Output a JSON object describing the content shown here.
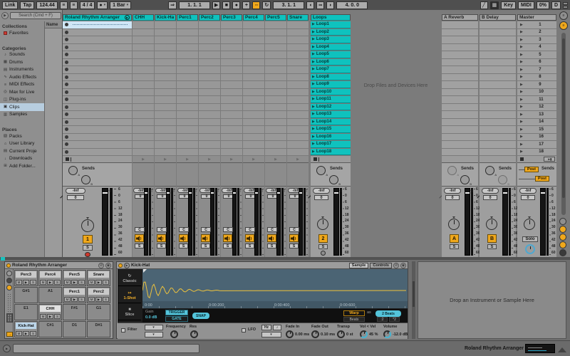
{
  "transport": {
    "link": "Link",
    "tap": "Tap",
    "tempo": "124.44",
    "time_sig": "4 / 4",
    "quantize": "1 Bar",
    "position": "1. 1. 1",
    "loop_start": "3. 1. 1",
    "loop_length": "4. 0. 0",
    "key_label": "Key",
    "midi_label": "MIDI",
    "cpu": "0%",
    "disk": "D"
  },
  "icons": {
    "dropdown": "▾",
    "nudge": "≡",
    "metronome": "●",
    "follow": "⇒",
    "play": "▶",
    "stop": "■",
    "record": "●",
    "new": "+",
    "automation_arm": "◦◦",
    "reenable_automation": "↻",
    "punch_in": "◖",
    "loop": "∞",
    "punch_out": "◗",
    "pencil": "╱",
    "keyboard": "▦",
    "browser_toggle": "▶",
    "unfold": "▶",
    "clip_play": "▶",
    "scene_play": "▶",
    "clip_stop": "■",
    "track_stop": "▶",
    "stop_all_label": "►▮",
    "hot_swap": "⊘",
    "save": "◉",
    "zero_marker": "◁",
    "overview": "≡",
    "mixer_rail": "≡",
    "arrow": "→",
    "info_play": "▶",
    "mode_classic_icon": "↻",
    "mode_oneshot_icon": "↦",
    "mode_slice_icon": "■",
    "start_flag": "▶"
  },
  "browser": {
    "search_placeholder": "Search (Cmd + F)",
    "name_header": "Name",
    "sections": [
      {
        "title": "Collections",
        "items": [
          {
            "label": "Favorites",
            "icon": "swatch"
          }
        ]
      },
      {
        "title": "Categories",
        "items": [
          {
            "label": "Sounds",
            "icon": "♪"
          },
          {
            "label": "Drums",
            "icon": "▦"
          },
          {
            "label": "Instruments",
            "icon": "▤"
          },
          {
            "label": "Audio Effects",
            "icon": "∿"
          },
          {
            "label": "MIDI Effects",
            "icon": "≡"
          },
          {
            "label": "Max for Live",
            "icon": "◎"
          },
          {
            "label": "Plug-ins",
            "icon": "◫"
          },
          {
            "label": "Clips",
            "icon": "▣",
            "selected": true
          },
          {
            "label": "Samples",
            "icon": "▥"
          }
        ]
      },
      {
        "title": "Places",
        "items": [
          {
            "label": "Packs",
            "icon": "▧"
          },
          {
            "label": "User Library",
            "icon": "⌂"
          },
          {
            "label": "Current Proje",
            "icon": "▤"
          },
          {
            "label": "Downloads",
            "icon": "↓"
          },
          {
            "label": "Add Folder...",
            "icon": "⊞"
          }
        ]
      }
    ]
  },
  "session": {
    "group_track": {
      "name": "Roland Rhythm Arranger"
    },
    "tracks": [
      "CHH",
      "Kick-Hat",
      "Perc1",
      "Perc2",
      "Perc3",
      "Perc4",
      "Perc5",
      "Snare"
    ],
    "loops_track": {
      "name": "Loops",
      "clips": [
        "Loop1",
        "Loop2",
        "Loop3",
        "Loop4",
        "Loop5",
        "Loop6",
        "Loop7",
        "Loop8",
        "Loop9",
        "Loop10",
        "Loop11",
        "Loop12",
        "Loop13",
        "Loop14",
        "Loop15",
        "Loop16",
        "Loop17",
        "Loop18"
      ]
    },
    "drop_text": "Drop Files and Devices Here",
    "returns": [
      {
        "name": "A Reverb",
        "activator": "A"
      },
      {
        "name": "B Delay",
        "activator": "B"
      }
    ],
    "master": {
      "name": "Master",
      "scenes": [
        "1",
        "2",
        "3",
        "4",
        "5",
        "6",
        "7",
        "8",
        "9",
        "10",
        "11",
        "12",
        "13",
        "14",
        "15",
        "16",
        "17",
        "18"
      ]
    }
  },
  "mixer": {
    "sends_label": "Sends",
    "send_a": "A",
    "send_b": "B",
    "post": "Post",
    "volume_display": "-Inf",
    "pan_display": "0",
    "pan_center": "C",
    "solo": "S",
    "master_solo": "Solo",
    "group_activator": "1",
    "loops_activator": "2",
    "db_scale": [
      "6",
      "0",
      "6",
      "12",
      "18",
      "24",
      "30",
      "36",
      "42",
      "48",
      "60"
    ]
  },
  "detail": {
    "drum_rack": {
      "title": "Roland Rhythm Arranger",
      "mute": "M",
      "play": "▶",
      "solo": "S",
      "pads": [
        {
          "name": "Perc3",
          "filled": true
        },
        {
          "name": "Perc4",
          "filled": true
        },
        {
          "name": "Perc5",
          "filled": true
        },
        {
          "name": "Snare",
          "filled": true
        },
        {
          "name": "G#1",
          "filled": false
        },
        {
          "name": "A1",
          "filled": false
        },
        {
          "name": "Perc1",
          "filled": true
        },
        {
          "name": "Perc2",
          "filled": true
        },
        {
          "name": "E1",
          "filled": false
        },
        {
          "name": "CHH",
          "filled": true,
          "state": "selected"
        },
        {
          "name": "F#1",
          "filled": false
        },
        {
          "name": "G1",
          "filled": false
        },
        {
          "name": "Kick-Hat",
          "filled": true,
          "state": "playing"
        },
        {
          "name": "C#1",
          "filled": false
        },
        {
          "name": "D1",
          "filled": false
        },
        {
          "name": "D#1",
          "filled": false
        }
      ]
    },
    "simpler": {
      "title": "Kick-Hat",
      "tabs": [
        "Sample",
        "Controls"
      ],
      "modes": [
        "Classic",
        "1-Shot",
        "Slice"
      ],
      "active_mode": "1-Shot",
      "time_labels": [
        "0:00",
        "0:00:200",
        "0:00:400",
        "0:00:600"
      ],
      "gain_label": "Gain",
      "gain_value": "0.0 dB",
      "trigger": "TRIGGER",
      "gate": "GATE",
      "snap": "SNAP",
      "warp": "Warp",
      "as_label": "as",
      "length_value": "2 Beats",
      "warp_mode": "Beats",
      "half": ":2",
      "double": "*2",
      "filter_label": "Filter",
      "frequency_label": "Frequency",
      "res_label": "Res",
      "lfo_label": "LFO",
      "hz_label": "Hz",
      "note_label": "♪",
      "params": [
        {
          "label": "Fade In",
          "value": "0.00 ms"
        },
        {
          "label": "Fade Out",
          "value": "0.10 ms"
        },
        {
          "label": "Transp",
          "value": "0 st"
        },
        {
          "label": "Vol < Vel",
          "value": "45 %"
        },
        {
          "label": "Volume",
          "value": "-12.0 dB"
        }
      ]
    },
    "drop_text": "Drop an Instrument or Sample Here"
  },
  "status": {
    "device_name": "Roland Rhythm Arranger"
  },
  "colors": {
    "accent_cyan": "#0fc2be",
    "accent_amber": "#f0a81c",
    "selected_blue": "#cfe6f6",
    "record_red": "#cf382c",
    "lcd_cyan": "#54c4da",
    "wave_bg": "#4b6474",
    "wave_line": "#edc23c"
  }
}
